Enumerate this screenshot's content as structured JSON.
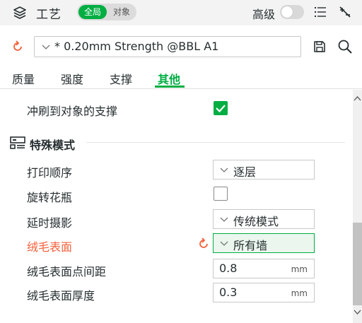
{
  "header": {
    "title": "工艺",
    "scope_active": "全局",
    "scope_inactive": "对象",
    "advanced_label": "高级"
  },
  "preset": {
    "name": "* 0.20mm Strength @BBL A1"
  },
  "tabs": [
    {
      "label": "质量",
      "active": false
    },
    {
      "label": "强度",
      "active": false
    },
    {
      "label": "支撑",
      "active": false
    },
    {
      "label": "其他",
      "active": true
    }
  ],
  "settings": {
    "flush_to_support": {
      "label": "冲刷到对象的支撑",
      "checked": true
    },
    "special_mode": {
      "title": "特殊模式",
      "print_sequence": {
        "label": "打印顺序",
        "value": "逐层"
      },
      "spiral_vase": {
        "label": "旋转花瓶",
        "checked": false
      },
      "timelapse": {
        "label": "延时摄影",
        "value": "传统模式"
      },
      "fuzzy_skin": {
        "label": "绒毛表面",
        "value": "所有墙"
      },
      "fuzzy_skin_point_distance": {
        "label": "绒毛表面点间距",
        "value": "0.8",
        "unit": "mm"
      },
      "fuzzy_skin_thickness": {
        "label": "绒毛表面厚度",
        "value": "0.3",
        "unit": "mm"
      }
    }
  },
  "colors": {
    "accent": "#00ae42",
    "changed": "#f4613a"
  },
  "icons": {
    "header": "process-layers-icon",
    "list": "list-icon",
    "compare": "compare-icon",
    "reset": "reset-icon",
    "save": "save-icon",
    "search": "search-icon",
    "section": "special-mode-icon"
  }
}
